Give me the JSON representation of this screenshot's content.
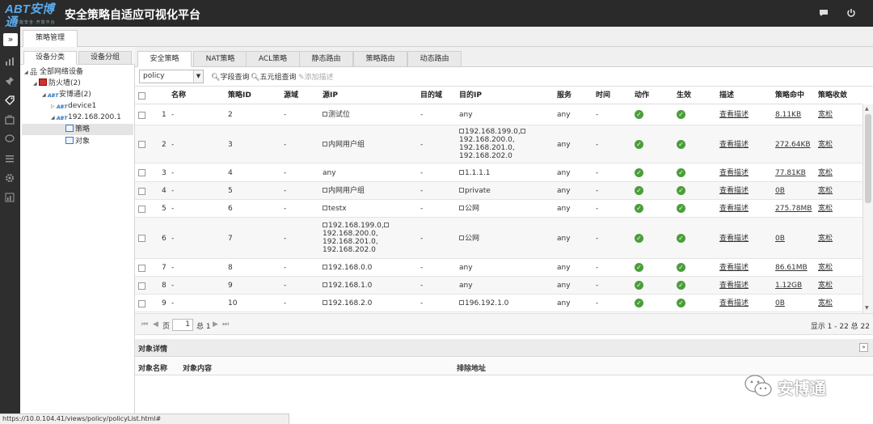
{
  "header": {
    "logo_text": "ABT安博通",
    "logo_sub": "智能安全·开放平台",
    "title": "安全策略自适应可视化平台"
  },
  "top_tab": "策略管理",
  "left_tabs": [
    "设备分类",
    "设备分组"
  ],
  "tree": {
    "root": "全部网络设备",
    "firewall": "防火墙(2)",
    "vendor": "安博通(2)",
    "device1": "device1",
    "ip": "192.168.200.1",
    "policy": "策略",
    "object": "对象"
  },
  "main_tabs": [
    "安全策略",
    "NAT策略",
    "ACL策略",
    "静态路由",
    "策略路由",
    "动态路由"
  ],
  "toolbar": {
    "select_value": "policy",
    "field_query": "字段查询",
    "tuple_query": "五元组查询",
    "add_desc": "添加描述"
  },
  "columns": {
    "name": "名称",
    "policy_id": "策略ID",
    "src_zone": "源域",
    "src_ip": "源IP",
    "dst_zone": "目的域",
    "dst_ip": "目的IP",
    "service": "服务",
    "time": "时间",
    "action": "动作",
    "effective": "生效",
    "desc": "描述",
    "hits": "策略命中",
    "tighten": "策略收敛"
  },
  "rows": [
    {
      "num": "1",
      "name": "-",
      "id": "2",
      "szone": "-",
      "sip": "测试位",
      "dzone": "-",
      "dip": "any",
      "svc": "any",
      "time": "-",
      "desc": "查看描述",
      "hits": "8.11KB",
      "tighten": "宽松"
    },
    {
      "num": "2",
      "name": "-",
      "id": "3",
      "szone": "-",
      "sip": "内网用户组",
      "dzone": "-",
      "dip_lines": [
        "192.168.199.0,",
        "192.168.200.0,",
        "192.168.201.0,",
        "192.168.202.0"
      ],
      "svc": "any",
      "time": "-",
      "desc": "查看描述",
      "hits": "272.64KB",
      "tighten": "宽松"
    },
    {
      "num": "3",
      "name": "-",
      "id": "4",
      "szone": "-",
      "sip": "any",
      "dzone": "-",
      "dip": "1.1.1.1",
      "svc": "any",
      "time": "-",
      "desc": "查看描述",
      "hits": "77.81KB",
      "tighten": "宽松"
    },
    {
      "num": "4",
      "name": "-",
      "id": "5",
      "szone": "-",
      "sip": "内网用户组",
      "dzone": "-",
      "dip": "private",
      "svc": "any",
      "time": "-",
      "desc": "查看描述",
      "hits": "0B",
      "tighten": "宽松"
    },
    {
      "num": "5",
      "name": "-",
      "id": "6",
      "szone": "-",
      "sip": "testx",
      "dzone": "-",
      "dip": "公网",
      "svc": "any",
      "time": "-",
      "desc": "查看描述",
      "hits": "275.78MB",
      "tighten": "宽松"
    },
    {
      "num": "6",
      "name": "-",
      "id": "7",
      "szone": "-",
      "sip_lines": [
        "192.168.199.0,",
        "192.168.200.0,",
        "192.168.201.0,",
        "192.168.202.0"
      ],
      "dzone": "-",
      "dip": "公网",
      "svc": "any",
      "time": "-",
      "desc": "查看描述",
      "hits": "0B",
      "tighten": "宽松"
    },
    {
      "num": "7",
      "name": "-",
      "id": "8",
      "szone": "-",
      "sip": "192.168.0.0",
      "dzone": "-",
      "dip": "any",
      "svc": "any",
      "time": "-",
      "desc": "查看描述",
      "hits": "86.61MB",
      "tighten": "宽松"
    },
    {
      "num": "8",
      "name": "-",
      "id": "9",
      "szone": "-",
      "sip": "192.168.1.0",
      "dzone": "-",
      "dip": "any",
      "svc": "any",
      "time": "-",
      "desc": "查看描述",
      "hits": "1.12GB",
      "tighten": "宽松"
    },
    {
      "num": "9",
      "name": "-",
      "id": "10",
      "szone": "-",
      "sip": "192.168.2.0",
      "dzone": "-",
      "dip": "196.192.1.0",
      "svc": "any",
      "time": "-",
      "desc": "查看描述",
      "hits": "0B",
      "tighten": "宽松"
    }
  ],
  "pager": {
    "page_label": "页",
    "page_value": "1",
    "total_label": "总 1",
    "summary": "显示 1 - 22 总 22"
  },
  "detail": {
    "title": "对象详情",
    "col_name": "对象名称",
    "col_content": "对象内容",
    "col_exclude": "排除地址"
  },
  "watermark": "安博通",
  "status_url": "https://10.0.104.41/views/policy/policyList.html#",
  "colors": {
    "header_bg": "#2a2a2a",
    "rail_bg": "#2e2e2e",
    "ok_green": "#4a9e3a",
    "logo_blue": "#5aa8e8"
  }
}
